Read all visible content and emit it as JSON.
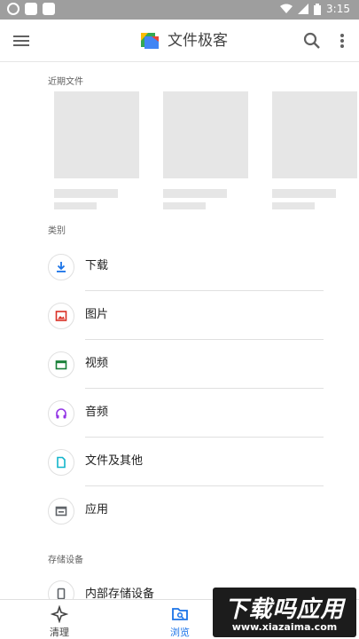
{
  "status_bar": {
    "time": "3:15"
  },
  "app_bar": {
    "title": "文件极客",
    "menu_icon": "menu-icon",
    "search_icon": "search-icon",
    "more_icon": "more-vert-icon"
  },
  "recent": {
    "label": "近期文件"
  },
  "categories": {
    "label": "类别",
    "items": [
      {
        "label": "下载",
        "icon": "download-icon",
        "color": "#1a73e8"
      },
      {
        "label": "图片",
        "icon": "image-icon",
        "color": "#d93025"
      },
      {
        "label": "视频",
        "icon": "video-icon",
        "color": "#188038"
      },
      {
        "label": "音频",
        "icon": "headphones-icon",
        "color": "#9334e6"
      },
      {
        "label": "文件及其他",
        "icon": "document-icon",
        "color": "#12b5cb"
      },
      {
        "label": "应用",
        "icon": "app-icon",
        "color": "#5f6368"
      }
    ]
  },
  "storage": {
    "label": "存储设备",
    "item_label": "内部存储设备"
  },
  "bottom_nav": {
    "clean_label": "清理",
    "browse_label": "浏览",
    "active_color": "#1a73e8"
  },
  "watermark": {
    "logo_text": "下载吗应用",
    "url": "www.xiazaima.com"
  }
}
